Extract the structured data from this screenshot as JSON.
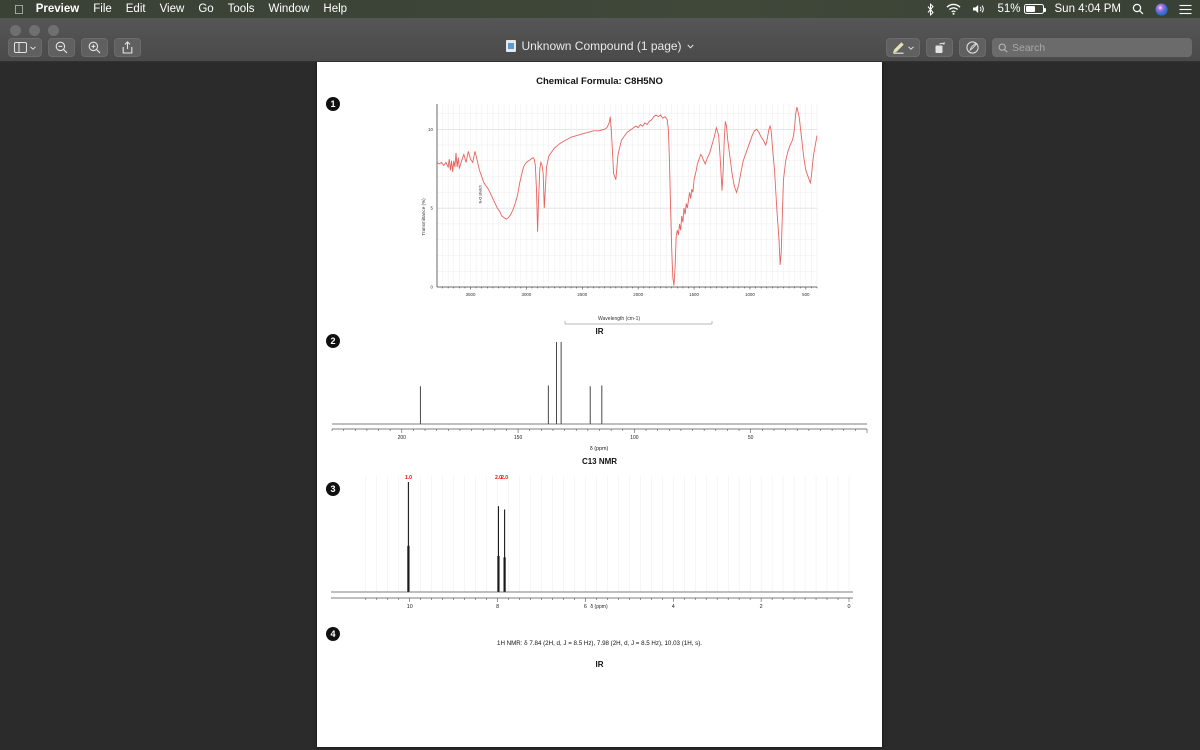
{
  "menubar": {
    "apple_icon": "apple-icon",
    "items": [
      {
        "label": "Preview",
        "bold": true
      },
      {
        "label": "File",
        "bold": false
      },
      {
        "label": "Edit",
        "bold": false
      },
      {
        "label": "View",
        "bold": false
      },
      {
        "label": "Go",
        "bold": false
      },
      {
        "label": "Tools",
        "bold": false
      },
      {
        "label": "Window",
        "bold": false
      },
      {
        "label": "Help",
        "bold": false
      }
    ],
    "status": {
      "bluetooth_icon": "bluetooth-icon",
      "wifi_icon": "wifi-icon",
      "volume_icon": "volume-icon",
      "battery_percent": "51%",
      "battery_icon": "battery-icon",
      "clock": "Sun 4:04 PM",
      "spotlight_icon": "search-icon",
      "siri_icon": "siri-icon",
      "control_center_icon": "control-center-icon"
    }
  },
  "toolbar": {
    "sidebar_button": "sidebar-toggle",
    "zoom_out_button": "zoom-out",
    "zoom_in_button": "zoom-in",
    "share_button": "share",
    "markup_button": "markup-pen",
    "rotate_button": "rotate-left",
    "annotate_button": "annotate",
    "document_title": "Unknown Compound (1 page)",
    "search": {
      "value": "",
      "placeholder": "Search"
    }
  },
  "document": {
    "title": "Chemical Formula: C8H5NO",
    "badges": [
      "1",
      "2",
      "3",
      "4"
    ],
    "ir_label": "IR",
    "c13_label": "C13 NMR",
    "bottom_label": "IR",
    "nmr_caption": "1H NMR: δ 7.84 (2H, d, J = 8.5 Hz), 7.98 (2H, d, J = 8.5 Hz), 10.03 (1H, s)."
  },
  "chart_data": [
    {
      "type": "line",
      "name": "ir-spectrum",
      "title": "IR",
      "xlabel": "Wavelength (cm-1)",
      "ylabel": "Transmittance (%)",
      "xlim": [
        3800,
        400
      ],
      "ylim": [
        0,
        11.6
      ],
      "xticks": [
        3500,
        3000,
        2500,
        2000,
        1500,
        1000,
        500
      ],
      "yticks": [
        0,
        5,
        10
      ],
      "grid": true,
      "color": "#e8645f",
      "annotations": [
        {
          "text": "N-O stretch",
          "x": 3400,
          "y": 5.3,
          "rotation": -90
        }
      ],
      "x": [
        3800,
        3780,
        3760,
        3740,
        3720,
        3700,
        3690,
        3680,
        3670,
        3660,
        3650,
        3640,
        3630,
        3620,
        3610,
        3600,
        3580,
        3560,
        3540,
        3520,
        3500,
        3480,
        3460,
        3440,
        3420,
        3400,
        3380,
        3360,
        3340,
        3320,
        3300,
        3280,
        3260,
        3240,
        3220,
        3200,
        3180,
        3160,
        3140,
        3120,
        3100,
        3080,
        3070,
        3060,
        3050,
        3040,
        3030,
        3020,
        3000,
        2980,
        2960,
        2940,
        2930,
        2920,
        2910,
        2900,
        2890,
        2880,
        2870,
        2860,
        2850,
        2840,
        2820,
        2800,
        2750,
        2700,
        2650,
        2600,
        2550,
        2500,
        2450,
        2400,
        2350,
        2300,
        2280,
        2260,
        2250,
        2240,
        2230,
        2220,
        2200,
        2180,
        2150,
        2120,
        2100,
        2080,
        2060,
        2040,
        2020,
        2000,
        1980,
        1960,
        1940,
        1920,
        1900,
        1880,
        1860,
        1840,
        1820,
        1800,
        1780,
        1760,
        1740,
        1730,
        1720,
        1710,
        1700,
        1690,
        1680,
        1670,
        1660,
        1650,
        1640,
        1630,
        1620,
        1610,
        1600,
        1590,
        1580,
        1570,
        1560,
        1550,
        1540,
        1530,
        1520,
        1510,
        1500,
        1490,
        1480,
        1470,
        1460,
        1450,
        1440,
        1430,
        1420,
        1400,
        1380,
        1360,
        1340,
        1320,
        1300,
        1280,
        1270,
        1260,
        1250,
        1240,
        1230,
        1220,
        1210,
        1200,
        1180,
        1160,
        1140,
        1120,
        1100,
        1080,
        1060,
        1040,
        1020,
        1000,
        980,
        960,
        940,
        920,
        900,
        880,
        860,
        850,
        840,
        830,
        820,
        810,
        800,
        780,
        760,
        740,
        730,
        720,
        710,
        700,
        680,
        660,
        640,
        620,
        610,
        600,
        590,
        580,
        560,
        540,
        520,
        500,
        480,
        460,
        450,
        440,
        430,
        420,
        410,
        400
      ],
      "y": [
        7.9,
        7.8,
        7.9,
        7.7,
        7.9,
        7.6,
        8.1,
        7.4,
        8.0,
        7.3,
        8.0,
        7.6,
        8.5,
        7.6,
        8.2,
        7.5,
        8.0,
        8.4,
        7.9,
        8.6,
        8.1,
        7.9,
        8.6,
        8.0,
        7.4,
        7.0,
        6.6,
        6.4,
        6.2,
        5.9,
        5.6,
        5.3,
        5.0,
        4.8,
        4.5,
        4.4,
        4.3,
        4.4,
        4.6,
        4.9,
        5.3,
        5.8,
        6.2,
        6.6,
        6.9,
        7.2,
        7.5,
        7.7,
        7.9,
        8.0,
        8.1,
        8.2,
        8.1,
        7.7,
        6.2,
        3.5,
        5.8,
        7.5,
        7.9,
        7.7,
        7.2,
        5.0,
        7.6,
        8.3,
        8.8,
        9.1,
        9.3,
        9.5,
        9.6,
        9.7,
        9.8,
        9.9,
        9.9,
        10.0,
        10.1,
        10.4,
        10.8,
        9.9,
        8.6,
        7.2,
        6.8,
        8.4,
        9.3,
        9.6,
        9.8,
        9.9,
        10.0,
        10.1,
        10.2,
        10.1,
        10.3,
        10.2,
        10.4,
        10.3,
        10.5,
        10.6,
        10.8,
        10.9,
        10.8,
        10.9,
        10.7,
        10.8,
        10.6,
        10.0,
        8.0,
        5.0,
        2.4,
        0.6,
        0.1,
        1.2,
        3.2,
        3.6,
        3.3,
        4.0,
        3.6,
        4.5,
        4.1,
        5.0,
        4.6,
        5.3,
        5.0,
        5.5,
        6.0,
        5.6,
        6.2,
        6.0,
        6.8,
        7.1,
        7.4,
        7.8,
        8.0,
        8.2,
        8.4,
        8.3,
        8.1,
        7.8,
        8.2,
        8.5,
        9.0,
        9.5,
        10.1,
        9.6,
        8.6,
        7.4,
        6.1,
        7.3,
        9.3,
        10.5,
        10.2,
        9.4,
        8.3,
        7.2,
        6.4,
        6.0,
        6.5,
        7.3,
        8.0,
        8.4,
        8.8,
        9.2,
        9.6,
        9.9,
        10.0,
        9.8,
        9.5,
        9.3,
        9.0,
        9.2,
        9.6,
        10.0,
        10.2,
        9.9,
        9.0,
        7.4,
        5.0,
        3.0,
        1.4,
        2.2,
        4.6,
        6.8,
        8.0,
        8.6,
        9.0,
        9.3,
        9.6,
        10.2,
        11.0,
        11.4,
        10.8,
        9.6,
        8.3,
        7.4,
        7.0,
        6.6,
        7.0,
        7.8,
        8.4,
        8.8,
        9.2,
        9.6,
        9.9,
        10.1,
        9.8,
        9.4,
        9.0,
        8.0,
        6.2,
        4.0,
        2.0,
        1.6,
        2.8,
        4.8,
        6.5,
        7.6,
        8.2,
        8.6,
        8.9,
        9.1,
        8.9,
        8.4,
        7.7,
        7.9,
        8.0,
        7.5,
        8.2,
        8.0,
        7.6,
        8.1,
        7.8,
        7.9
      ]
    },
    {
      "type": "stem",
      "name": "c13-nmr-spectrum",
      "title": "C13 NMR",
      "xlabel": "δ (ppm)",
      "ylabel": "",
      "xlim": [
        230,
        0
      ],
      "ylim": [
        0,
        1.05
      ],
      "xticks": [
        200,
        150,
        100,
        50
      ],
      "grid": false,
      "color": "#333333",
      "peaks": [
        {
          "shift": 192.0,
          "intensity": 0.46
        },
        {
          "shift": 137.0,
          "intensity": 0.47
        },
        {
          "shift": 133.5,
          "intensity": 1.0
        },
        {
          "shift": 131.5,
          "intensity": 1.0
        },
        {
          "shift": 119.0,
          "intensity": 0.46
        },
        {
          "shift": 114.0,
          "intensity": 0.47
        }
      ]
    },
    {
      "type": "stem",
      "name": "h1-nmr-spectrum",
      "title": "1H NMR",
      "xlabel": "δ (ppm)",
      "ylabel": "",
      "xlim": [
        11.2,
        0
      ],
      "ylim": [
        0,
        1.05
      ],
      "xticks": [
        10,
        8,
        6,
        4,
        2,
        0
      ],
      "grid": true,
      "color": "#1a1a1a",
      "label_color": "#ff0000",
      "peaks": [
        {
          "shift": 10.03,
          "intensity": 1.0,
          "label": "1.0"
        },
        {
          "shift": 7.98,
          "intensity": 0.78,
          "label": "2.0"
        },
        {
          "shift": 7.84,
          "intensity": 0.75,
          "label": "2.0"
        }
      ]
    }
  ]
}
